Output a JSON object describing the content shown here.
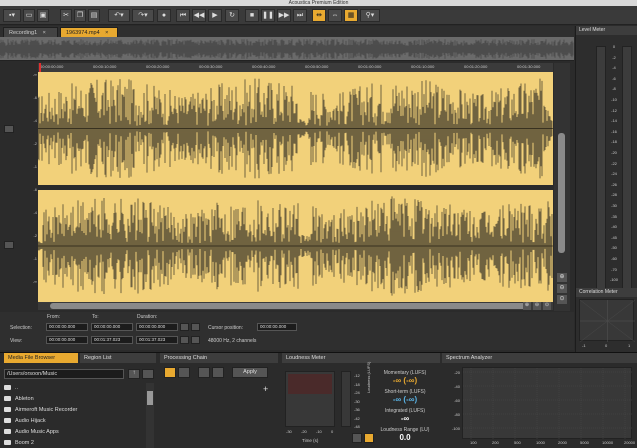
{
  "window": {
    "title": "Acoustica Premium Edition"
  },
  "tabs": [
    {
      "label": "Recording1",
      "close": "×"
    },
    {
      "label": "1963974.mp4",
      "close": "×"
    }
  ],
  "timeline": {
    "ticks": [
      "00:00:00.000",
      "00:00:10.000",
      "00:00:20.000",
      "00:00:30.000",
      "00:00:40.000",
      "00:00:50.000",
      "00:01:00.000",
      "00:01:10.000",
      "00:01:20.000",
      "00:01:30.000"
    ]
  },
  "db_scale": [
    "-∞",
    "-6",
    "-4",
    "-2",
    "-1",
    "-6",
    "-4",
    "-2",
    "-1",
    "-∞"
  ],
  "selection": {
    "labels": {
      "from": "From:",
      "to": "To:",
      "duration": "Duration:",
      "selection": "Selection:",
      "view": "View:",
      "cursor": "Cursor position:"
    },
    "sel_from": "00:00:00.000",
    "sel_to": "00:00:00.000",
    "sel_duration": "00:00:00.000",
    "view_from": "00:00:00.000",
    "view_to": "00:01:37.023",
    "view_duration": "00:01:37.023",
    "cursor": "00:00:00.000",
    "format": "48000 Hz, 2 channels"
  },
  "level_meter": {
    "title": "Level Meter",
    "scale": [
      "0",
      "-2",
      "-4",
      "-6",
      "-8",
      "-10",
      "-12",
      "-14",
      "-16",
      "-18",
      "-20",
      "-22",
      "-24",
      "-26",
      "-28",
      "-30",
      "-35",
      "-40",
      "-45",
      "-50",
      "-60",
      "-70",
      "-100"
    ],
    "bottom_left": "-100",
    "bottom_right": "-100"
  },
  "correlation_meter": {
    "title": "Correlation Meter",
    "left": "-1",
    "center": "0",
    "right": "1"
  },
  "media_browser": {
    "title": "Media File Browser",
    "path": "/Users/orsoon/Music",
    "items": [
      "..",
      "Ableton",
      "Airmeroft Music Recorder",
      "Audio Hijack",
      "Audio Music Apps",
      "Boom 2"
    ]
  },
  "region_list": {
    "title": "Region List"
  },
  "processing_chain": {
    "title": "Processing Chain",
    "apply_label": "Apply",
    "add": "+"
  },
  "loudness_meter": {
    "title": "Loudness Meter",
    "momentary_label": "Momentary (LUFS)",
    "momentary_value": "-∞ (-∞)",
    "short_label": "Short-term (LUFS)",
    "short_value": "-∞ (-∞)",
    "integrated_label": "Integrated (LUFS)",
    "integrated_value": "-∞",
    "range_label": "Loudness Range (LU)",
    "range_value": "0.0",
    "scale": [
      "-12",
      "-18",
      "-24",
      "-30",
      "-36",
      "-42",
      "-48"
    ],
    "xaxis": [
      "-30",
      "-20",
      "-10",
      "0"
    ],
    "xlabel": "Time (s)",
    "ylabel": "Loudness (LUFS)"
  },
  "spectrum": {
    "title": "Spectrum Analyzer",
    "yaxis": [
      "-20",
      "-40",
      "-60",
      "-80",
      "-100"
    ],
    "xaxis": [
      "100",
      "200",
      "500",
      "1000",
      "2000",
      "5000",
      "10000",
      "20000"
    ]
  },
  "colors": {
    "accent": "#e8a930",
    "waveform_bg": "#f2d17a",
    "waveform": "#1a1a1a",
    "panel": "#2b2b2b"
  }
}
